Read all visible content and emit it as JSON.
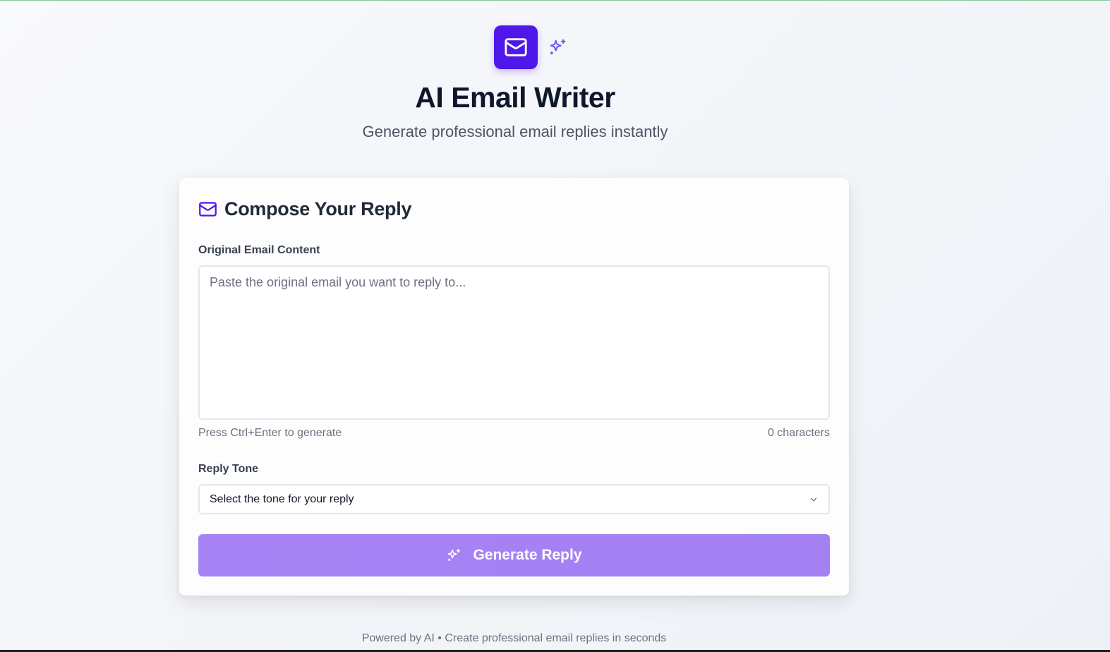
{
  "header": {
    "logo_icon": "mail-icon",
    "accent_icon": "sparkles-icon",
    "title": "AI Email Writer",
    "subtitle": "Generate professional email replies instantly"
  },
  "card": {
    "heading_icon": "mail-icon",
    "heading": "Compose Your Reply",
    "email_label": "Original Email Content",
    "email_placeholder": "Paste the original email you want to reply to...",
    "email_value": "",
    "hint": "Press Ctrl+Enter to generate",
    "char_count": "0 characters",
    "tone_label": "Reply Tone",
    "tone_placeholder": "Select the tone for your reply",
    "generate_label": "Generate Reply",
    "generate_icon": "sparkles-icon"
  },
  "footer": {
    "text": "Powered by AI • Create professional email replies in seconds"
  },
  "colors": {
    "brand": "#4f17e8",
    "accent_light": "#6d5ef0",
    "button": "#a784f5"
  }
}
